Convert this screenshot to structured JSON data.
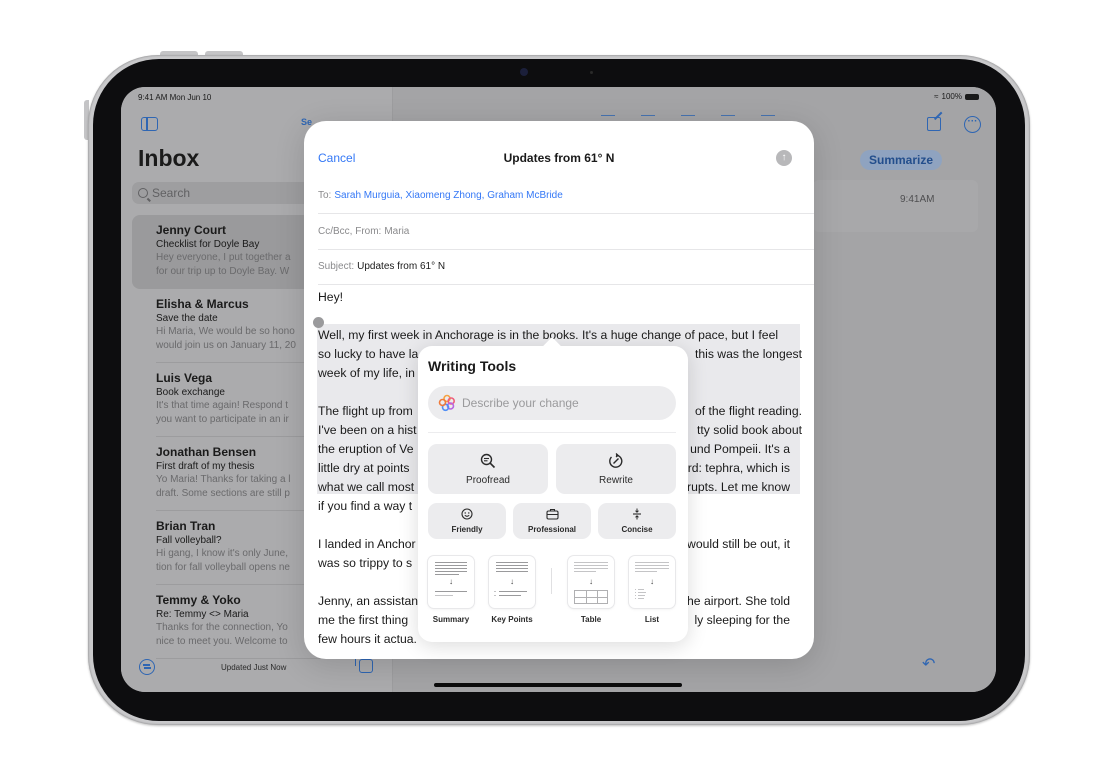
{
  "status_bar": {
    "time_date": "9:41 AM   Mon Jun 10",
    "battery": "100%"
  },
  "sidebar": {
    "title": "Inbox",
    "select_label": "Se",
    "search_placeholder": "Search",
    "mails": [
      {
        "sender": "Jenny Court",
        "subject": "Checklist for Doyle Bay",
        "preview1": "Hey everyone, I put together a",
        "preview2": "for our trip up to Doyle Bay. W",
        "selected": true
      },
      {
        "sender": "Elisha & Marcus",
        "subject": "Save the date",
        "preview1": "Hi Maria, We would be so hono",
        "preview2": "would join us on January 11, 20"
      },
      {
        "sender": "Luis Vega",
        "subject": "Book exchange",
        "preview1": "It's that time again! Respond t",
        "preview2": "you want to participate in an ir"
      },
      {
        "sender": "Jonathan Bensen",
        "subject": "First draft of my thesis",
        "preview1": "Yo Maria! Thanks for taking a l",
        "preview2": "draft. Some sections are still p"
      },
      {
        "sender": "Brian Tran",
        "subject": "Fall volleyball?",
        "preview1": "Hi gang, I know it's only June,",
        "preview2": "tion for fall volleyball opens ne"
      },
      {
        "sender": "Temmy & Yoko",
        "subject": "Re: Temmy <> Maria",
        "preview1": "Thanks for the connection, Yo",
        "preview2": "nice to meet you. Welcome to"
      }
    ],
    "footer_status": "Updated Just Now"
  },
  "detail": {
    "summarize_label": "Summarize",
    "message_time": "9:41AM"
  },
  "compose": {
    "cancel_label": "Cancel",
    "title": "Updates from 61° N",
    "to_label": "To:",
    "to_value": "Sarah Murguia, Xiaomeng Zhong, Graham McBride",
    "ccbcc_label": "Cc/Bcc, From:",
    "from_value": "Maria",
    "subject_label": "Subject:",
    "subject_value": "Updates from 61° N",
    "body": {
      "greeting": "Hey!",
      "p1_l1": "Well, my first week in Anchorage is in the books. It's a huge change of pace, but I feel",
      "p1_l2_left": "so lucky to have la",
      "p1_l2_right": "this was the longest",
      "p1_l3_left": "week of my life, in",
      "p2_l1_left": "The flight up from",
      "p2_l1_right": "of the flight reading.",
      "p2_l2_left": "I've been on a hist",
      "p2_l2_right": "tty solid book about",
      "p2_l3_left": "the eruption of Ve",
      "p2_l3_right": "und Pompeii. It's a",
      "p2_l4_left": "little dry at points",
      "p2_l4_right": "rd: tephra, which is",
      "p2_l5_left": "what we call most",
      "p2_l5_right": "rupts. Let me know",
      "p2_l6_left": "if you find a way t",
      "p3_l1_left": "I landed in Anchor",
      "p3_l1_right": "would still be out, it",
      "p3_l2_left": "was so trippy to s",
      "p4_l1_left": "Jenny, an assistan",
      "p4_l1_right": "he airport. She told",
      "p4_l2_left": "me the first thing",
      "p4_l2_right": "ly sleeping for the",
      "p4_l3_left": "few hours it actua."
    }
  },
  "writing_tools": {
    "title": "Writing Tools",
    "input_placeholder": "Describe your change",
    "primary_actions": [
      {
        "label": "Proofread",
        "icon": "magnifier-text-icon"
      },
      {
        "label": "Rewrite",
        "icon": "rewrite-icon"
      }
    ],
    "tone_actions": [
      {
        "label": "Friendly",
        "icon": "smiley-icon"
      },
      {
        "label": "Professional",
        "icon": "briefcase-icon"
      },
      {
        "label": "Concise",
        "icon": "concise-icon"
      }
    ],
    "format_actions": [
      {
        "label": "Summary"
      },
      {
        "label": "Key Points"
      },
      {
        "label": "Table"
      },
      {
        "label": "List"
      }
    ]
  },
  "colors": {
    "accent_blue": "#3478f6",
    "dimmed_blue": "#2f66b3"
  }
}
